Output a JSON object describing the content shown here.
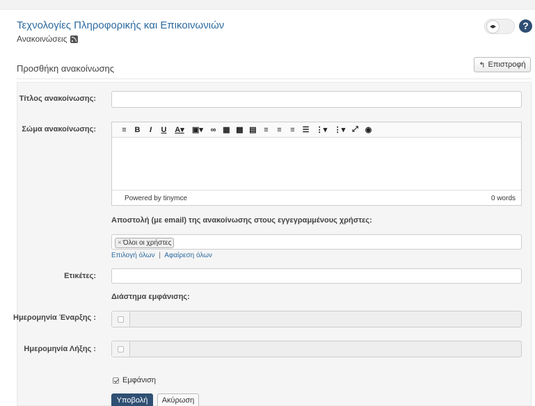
{
  "header": {
    "course_title": "Τεχνολογίες Πληροφορικής και Επικοινωνιών",
    "breadcrumb": "Ανακοινώσεις",
    "help_symbol": "?"
  },
  "page": {
    "section_title": "Προσθήκη ανακοίνωσης",
    "back_label": "Επιστροφή"
  },
  "form": {
    "title_label": "Τίτλος ανακοίνωσης:",
    "title_value": "",
    "body_label": "Σώμα ανακοίνωσης:",
    "editor": {
      "toolbar_icons": [
        "format-icon",
        "bold-icon",
        "italic-icon",
        "underline-icon",
        "text-color-icon",
        "bg-color-icon",
        "link-icon",
        "image-icon",
        "media-icon",
        "file-icon",
        "align-left-icon",
        "align-center-icon",
        "align-right-icon",
        "align-justify-icon",
        "bullet-list-icon",
        "numbered-list-icon",
        "fullscreen-icon",
        "preview-icon"
      ],
      "powered_by": "Powered by tinymce",
      "word_count": "0 words"
    },
    "email_heading": "Αποστολή (με email) της ανακοίνωσης στους εγγεγραμμένους χρήστες:",
    "recipient_chip": "Όλοι οι χρήστες",
    "select_all": "Επιλογή όλων",
    "link_separator": "|",
    "remove_all": "Αφαίρεση όλων",
    "tags_label": "Ετικέτες:",
    "tags_value": "",
    "display_period_heading": "Διάστημα εμφάνισης:",
    "start_date_label": "Ημερομηνία Έναρξης :",
    "end_date_label": "Ημερομηνία Λήξης :",
    "show_label": "Εμφάνιση",
    "show_checked": true,
    "submit_label": "Υποβολή",
    "cancel_label": "Ακύρωση"
  },
  "colors": {
    "link": "#2d6a9f",
    "primary_button": "#2f4f73",
    "panel_bg": "#f5f5f5"
  }
}
